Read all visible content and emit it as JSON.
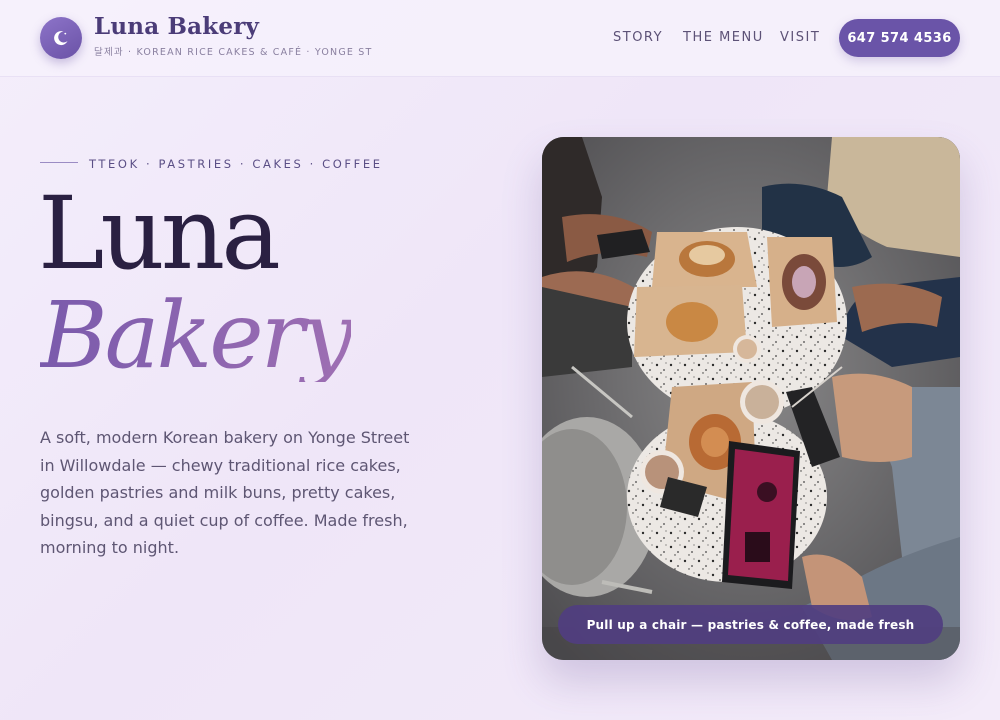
{
  "header": {
    "brand_name": "Luna Bakery",
    "brand_sub": "달제과 · KOREAN RICE CAKES & CAFÉ · YONGE ST",
    "logo_icon": "crescent-moon-icon",
    "nav": [
      "STORY",
      "THE MENU",
      "VISIT"
    ],
    "phone": "647 574 4536"
  },
  "hero": {
    "tagline": "TTEOK · PASTRIES · CAKES · COFFEE",
    "title_line1": "Luna",
    "title_line2": "Bakery",
    "description": "A soft, modern Korean bakery on Yonge Street in Willowdale — chewy traditional rice cakes, golden pastries and milk buns, pretty cakes, bingsu, and a quiet cup of coffee. Made fresh, morning to night."
  },
  "photo": {
    "caption": "Pull up a chair — pastries & coffee, made fresh"
  },
  "colors": {
    "accent": "#6a54a8",
    "title_dark": "#2a2042",
    "title_gradient_start": "#7a5aac",
    "title_gradient_end": "#9e6fb3",
    "background": "#f2eafa"
  }
}
